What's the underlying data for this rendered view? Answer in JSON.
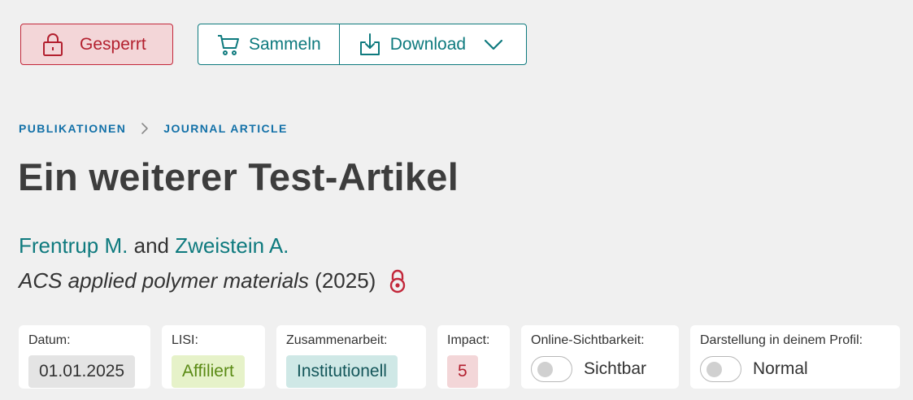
{
  "toolbar": {
    "locked_label": "Gesperrt",
    "collect_label": "Sammeln",
    "download_label": "Download"
  },
  "breadcrumb": {
    "items": [
      "PUBLIKATIONEN",
      "JOURNAL ARTICLE"
    ]
  },
  "article": {
    "title": "Ein weiterer Test-Artikel",
    "authors": [
      "Frentrup M.",
      "Zweistein A."
    ],
    "author_joiner": "and",
    "journal": "ACS applied polymer materials",
    "year": "(2025)"
  },
  "meta": {
    "datum_label": "Datum:",
    "datum_value": "01.01.2025",
    "lisi_label": "LISI:",
    "lisi_value": "Affiliert",
    "collab_label": "Zusammenarbeit:",
    "collab_value": "Institutionell",
    "impact_label": "Impact:",
    "impact_value": "5",
    "visibility_label": "Online-Sichtbarkeit:",
    "visibility_value": "Sichtbar",
    "profile_label": "Darstellung in deinem Profil:",
    "profile_value": "Normal"
  },
  "icons": {
    "locked": "lock-icon",
    "collect": "cart-icon",
    "download": "download-icon",
    "dropdown": "chevron-down-icon",
    "separator": "chevron-right-icon",
    "closed_access": "closed-access-icon"
  },
  "colors": {
    "teal": "#0e7a7e",
    "blue": "#1371a8",
    "red": "#b3202f",
    "background": "#f0f0f0"
  }
}
